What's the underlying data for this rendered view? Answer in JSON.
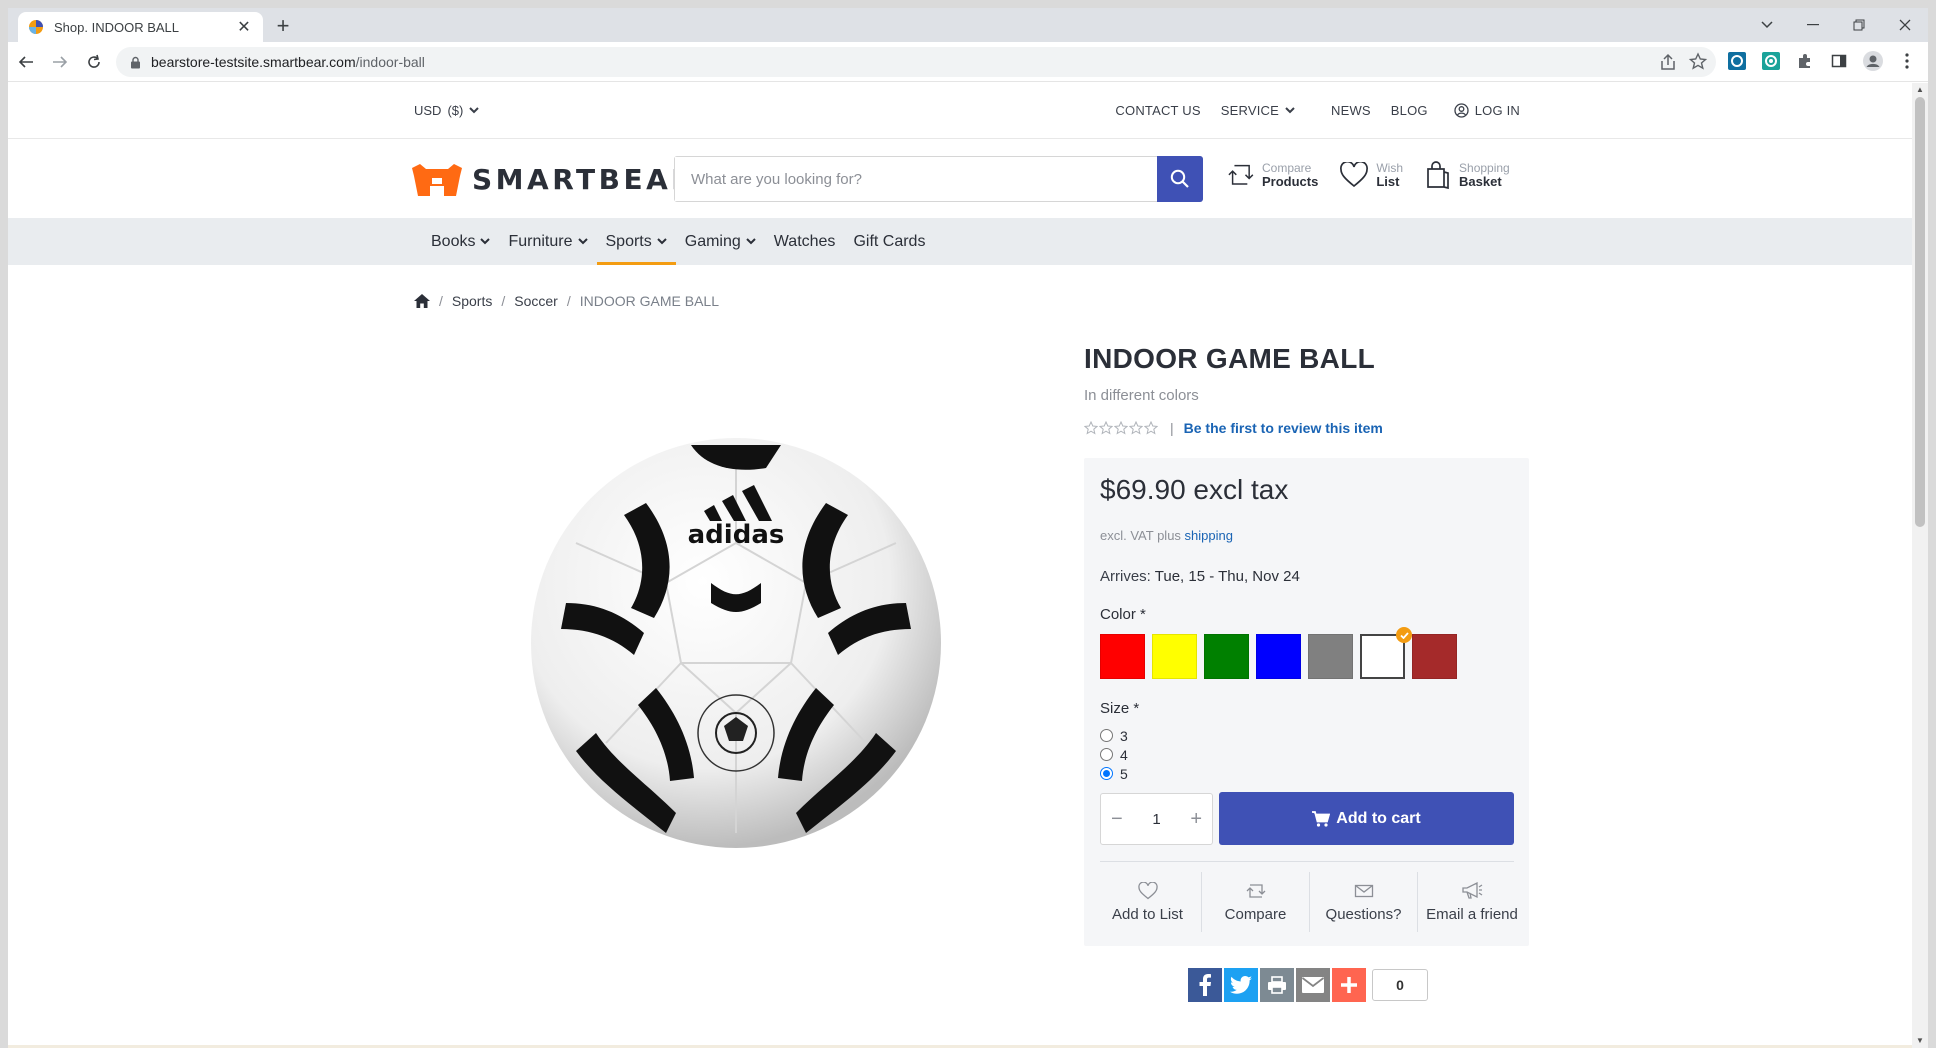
{
  "browser": {
    "tab_title": "Shop. INDOOR BALL",
    "url_host": "bearstore-testsite.smartbear.com",
    "url_path": "/indoor-ball"
  },
  "topbar": {
    "currency": "USD",
    "currency_symbol": "($)",
    "contact": "CONTACT US",
    "service": "SERVICE",
    "news": "NEWS",
    "blog": "BLOG",
    "login": "LOG IN"
  },
  "header": {
    "logo_text": "SMARTBEAR",
    "search_placeholder": "What are you looking for?",
    "compare_l1": "Compare",
    "compare_l2": "Products",
    "wish_l1": "Wish",
    "wish_l2": "List",
    "basket_l1": "Shopping",
    "basket_l2": "Basket"
  },
  "nav": {
    "items": [
      {
        "label": "Books",
        "dropdown": true
      },
      {
        "label": "Furniture",
        "dropdown": true
      },
      {
        "label": "Sports",
        "dropdown": true,
        "active": true
      },
      {
        "label": "Gaming",
        "dropdown": true
      },
      {
        "label": "Watches",
        "dropdown": false
      },
      {
        "label": "Gift Cards",
        "dropdown": false
      }
    ]
  },
  "breadcrumb": {
    "sports": "Sports",
    "soccer": "Soccer",
    "current": "INDOOR GAME BALL"
  },
  "product": {
    "title": "INDOOR GAME BALL",
    "subtitle": "In different colors",
    "rating_stars": 0,
    "review_link": "Be the first to review this item",
    "review_sep": "|",
    "price": "$69.90 excl tax",
    "vat_text": "excl. VAT plus",
    "vat_link": "shipping",
    "arrives_label": "Arrives:",
    "arrives_value": "Tue, 15 - Thu, Nov 24",
    "color_label": "Color *",
    "colors": [
      "#ff0000",
      "#ffff00",
      "#008000",
      "#0000ff",
      "#808080",
      "#ffffff",
      "#a52a2a"
    ],
    "selected_color": 5,
    "size_label": "Size *",
    "sizes": [
      "3",
      "4",
      "5"
    ],
    "selected_size": 2,
    "quantity": "1",
    "add_to_cart": "Add to cart",
    "actions": {
      "add_to_list": "Add to List",
      "compare": "Compare",
      "questions": "Questions?",
      "email": "Email a friend"
    },
    "share_count": "0",
    "ball_logo": "adidas"
  },
  "colors": {
    "primary": "#3f51b5",
    "accent": "#f39c12",
    "link": "#1a64b4",
    "logo_orange": "#ff6a13"
  }
}
